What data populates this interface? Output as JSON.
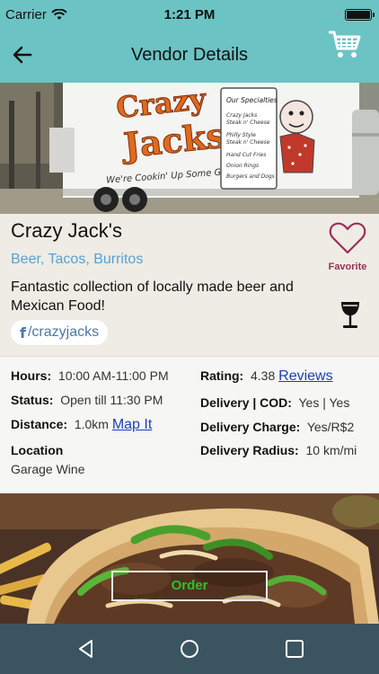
{
  "status_bar": {
    "carrier": "Carrier",
    "time": "1:21 PM"
  },
  "nav": {
    "title": "Vendor Details",
    "icons": {
      "back": "arrow-left-icon",
      "cart": "shopping-cart-icon"
    }
  },
  "vendor": {
    "name": "Crazy Jack's",
    "categories": "Beer, Tacos, Burritos",
    "description": "Fantastic collection of locally made beer and Mexican Food!",
    "facebook": "/crazyjacks",
    "favorite_label": "Favorite"
  },
  "details": {
    "hours_label": "Hours:",
    "hours_value": "10:00 AM-11:00 PM",
    "rating_label": "Rating:",
    "rating_value": "4.38",
    "reviews_link": "Reviews",
    "status_label": "Status:",
    "status_value": "Open till 11:30 PM",
    "delivery_cod_label": "Delivery | COD:",
    "delivery_cod_value": "Yes | Yes",
    "distance_label": "Distance:",
    "distance_value": "1.0km",
    "map_link": "Map It",
    "delivery_charge_label": "Delivery Charge:",
    "delivery_charge_value": "Yes/R$2",
    "location_label": "Location",
    "location_value": "Garage Wine",
    "delivery_radius_label": "Delivery Radius:",
    "delivery_radius_value": "10 km/mi"
  },
  "truck_sign": {
    "brand_line1": "Crazy",
    "brand_line2": "Jacks",
    "slogan": "We're Cookin' Up Some Good Food!",
    "menu_title": "Our Specialties",
    "menu_items": [
      "Crazy Jacks",
      "Steak n' Cheese",
      "Philly Style",
      "Steak n' Cheese",
      "Hand Cut Fries",
      "Onion Rings",
      "Burgers and Dogs"
    ]
  },
  "order_button": "Order",
  "colors": {
    "header": "#6cc3c3",
    "link": "#5a9fd0",
    "favorite": "#9b2f5a",
    "order_text": "#29c229",
    "android_nav": "#3a5560"
  }
}
